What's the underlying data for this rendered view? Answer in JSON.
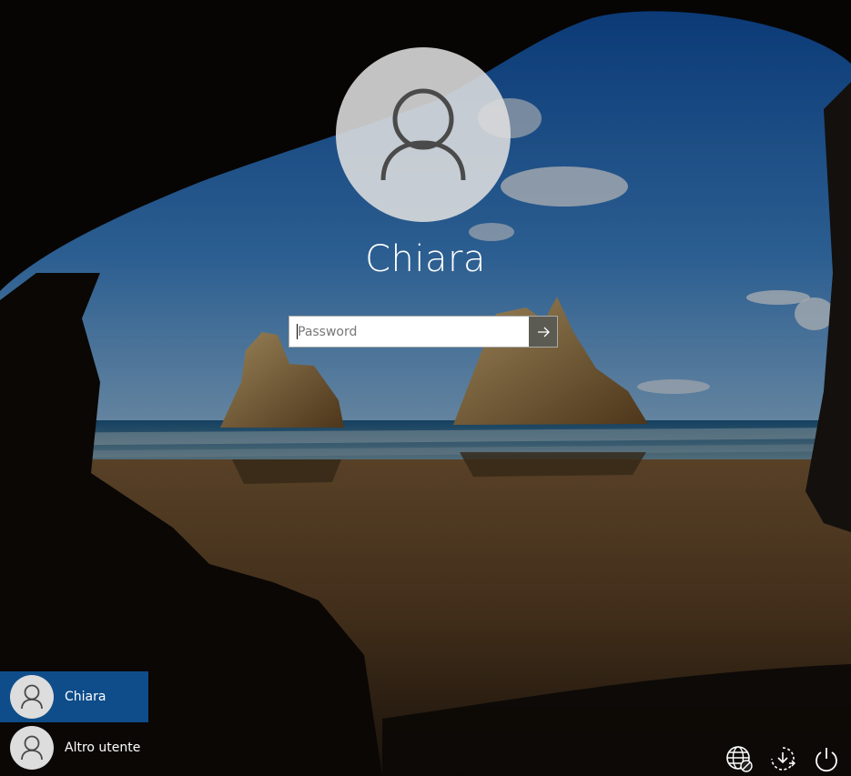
{
  "user": {
    "name": "Chiara"
  },
  "password": {
    "placeholder": "Password",
    "value": ""
  },
  "user_list": [
    {
      "name": "Chiara",
      "selected": true
    },
    {
      "name": "Altro utente",
      "selected": false
    }
  ],
  "corner_icons": [
    "network-icon",
    "ease-of-access-icon",
    "power-icon"
  ],
  "colors": {
    "selected_tile": "#0e4d8a",
    "submit_button": "#5b5b52"
  }
}
